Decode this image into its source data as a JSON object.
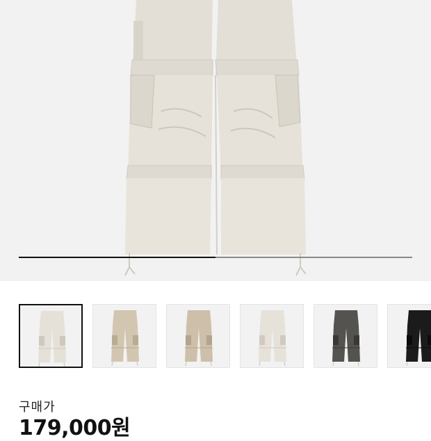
{
  "gallery": {
    "current_image_index": 1,
    "image_count": 6,
    "progress_fraction": 0.5,
    "thumbnails": [
      {
        "color": "#e5e1d8",
        "shade": "#cfc9bd",
        "selected": true
      },
      {
        "color": "#d3c6b1",
        "shade": "#b9ab94",
        "selected": false
      },
      {
        "color": "#cdbfa9",
        "shade": "#b2a48d",
        "selected": false
      },
      {
        "color": "#e6e2d9",
        "shade": "#d0cabf",
        "selected": false
      },
      {
        "color": "#55534f",
        "shade": "#3a3936",
        "selected": false
      },
      {
        "color": "#1b1b1b",
        "shade": "#0c0c0c",
        "selected": false
      }
    ]
  },
  "price": {
    "label": "구매가",
    "value": "179,000원"
  },
  "colors": {
    "hero_background": "#f2f2f2",
    "pants_main": "#e3dfd6"
  }
}
